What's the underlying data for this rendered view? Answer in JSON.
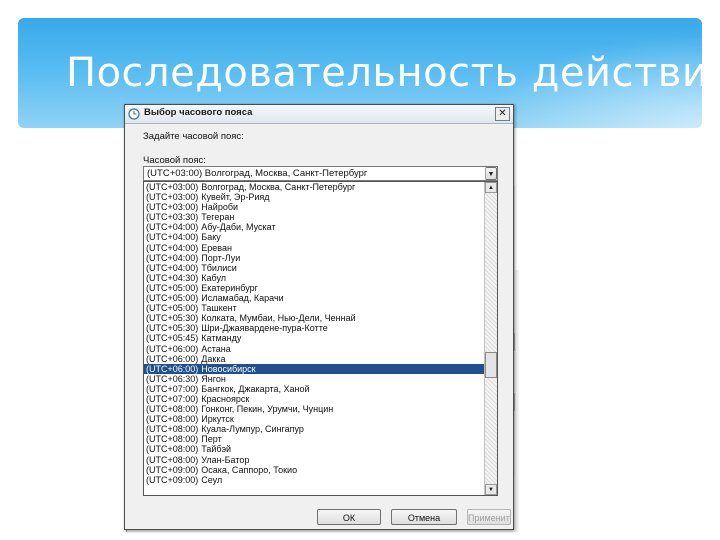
{
  "slide": {
    "title": "Последовательность действий"
  },
  "dialog": {
    "title": "Выбор часового пояса",
    "prompt": "Задайте часовой пояс:",
    "timezone_label": "Часовой пояс:",
    "selected_value": "(UTC+03:00) Волгоград, Москва, Санкт-Петербург",
    "ok_label": "ОК",
    "cancel_label": "Отмена",
    "apply_label": "Применить"
  },
  "timezones": [
    {
      "code": "(UTC+03:00)",
      "name": "Волгоград, Москва, Санкт-Петербург",
      "selected": false
    },
    {
      "code": "(UTC+03:00)",
      "name": "Кувейт, Эр-Рияд",
      "selected": false
    },
    {
      "code": "(UTC+03:00)",
      "name": "Найроби",
      "selected": false
    },
    {
      "code": "(UTC+03:30)",
      "name": "Тегеран",
      "selected": false
    },
    {
      "code": "(UTC+04:00)",
      "name": "Абу-Даби, Мускат",
      "selected": false
    },
    {
      "code": "(UTC+04:00)",
      "name": "Баку",
      "selected": false
    },
    {
      "code": "(UTC+04:00)",
      "name": "Ереван",
      "selected": false
    },
    {
      "code": "(UTC+04:00)",
      "name": "Порт-Луи",
      "selected": false
    },
    {
      "code": "(UTC+04:00)",
      "name": "Тбилиси",
      "selected": false
    },
    {
      "code": "(UTC+04:30)",
      "name": "Кабул",
      "selected": false
    },
    {
      "code": "(UTC+05:00)",
      "name": "Екатеринбург",
      "selected": false
    },
    {
      "code": "(UTC+05:00)",
      "name": "Исламабад, Карачи",
      "selected": false
    },
    {
      "code": "(UTC+05:00)",
      "name": "Ташкент",
      "selected": false
    },
    {
      "code": "(UTC+05:30)",
      "name": "Колката, Мумбаи, Нью-Дели, Ченнай",
      "selected": false
    },
    {
      "code": "(UTC+05:30)",
      "name": "Шри-Джаявардене-пура-Котте",
      "selected": false
    },
    {
      "code": "(UTC+05:45)",
      "name": "Катманду",
      "selected": false
    },
    {
      "code": "(UTC+06:00)",
      "name": "Астана",
      "selected": false
    },
    {
      "code": "(UTC+06:00)",
      "name": "Дакка",
      "selected": false
    },
    {
      "code": "(UTC+06:00)",
      "name": "Новосибирск",
      "selected": true
    },
    {
      "code": "(UTC+06:30)",
      "name": "Янгон",
      "selected": false
    },
    {
      "code": "(UTC+07:00)",
      "name": "Бангкок, Джакарта, Ханой",
      "selected": false
    },
    {
      "code": "(UTC+07:00)",
      "name": "Красноярск",
      "selected": false
    },
    {
      "code": "(UTC+08:00)",
      "name": "Гонконг, Пекин, Урумчи, Чунцин",
      "selected": false
    },
    {
      "code": "(UTC+08:00)",
      "name": "Иркутск",
      "selected": false
    },
    {
      "code": "(UTC+08:00)",
      "name": "Куала-Лумпур, Сингапур",
      "selected": false
    },
    {
      "code": "(UTC+08:00)",
      "name": "Перт",
      "selected": false
    },
    {
      "code": "(UTC+08:00)",
      "name": "Тайбэй",
      "selected": false
    },
    {
      "code": "(UTC+08:00)",
      "name": "Улан-Батор",
      "selected": false
    },
    {
      "code": "(UTC+09:00)",
      "name": "Осака, Саппоро, Токио",
      "selected": false
    },
    {
      "code": "(UTC+09:00)",
      "name": "Сеул",
      "selected": false
    }
  ],
  "colors": {
    "selection": "#1f4f8f",
    "header_blue": "#39a9ea"
  }
}
